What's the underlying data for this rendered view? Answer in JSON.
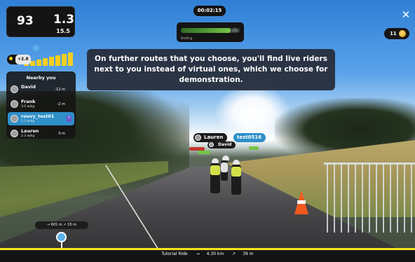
{
  "timer": "00:02:15",
  "stats": {
    "power": "93",
    "power_unit_top": "",
    "power_unit_bottom": "",
    "wkg": "1.3",
    "wkg_unit": "",
    "speed": "15.5"
  },
  "drafting": {
    "label": "Drafting",
    "level": 0.85
  },
  "message": "On further routes that you choose, you'll find live riders next to you instead of virtual ones, which we choose for demonstration.",
  "coins": {
    "count": "11"
  },
  "grade": {
    "value": "+2.8"
  },
  "nearby": {
    "title": "Nearby you",
    "riders": [
      {
        "name": "David",
        "wkg": "",
        "gap": "-12 m",
        "me": false
      },
      {
        "name": "Frank",
        "wkg": "3.0 w/kg",
        "gap": "-2 m",
        "me": false
      },
      {
        "name": "rouvy_test01",
        "wkg": "1.3 w/kg",
        "gap": "",
        "me": true,
        "badge": "7"
      },
      {
        "name": "Lauren",
        "wkg": "2.3 w/kg",
        "gap": "0 m",
        "me": false
      }
    ]
  },
  "world_tags": [
    {
      "name": "Lauren"
    },
    {
      "name": "test0516"
    },
    {
      "name": "David"
    }
  ],
  "distance_pill": {
    "distance": "601 m",
    "elevation": "15 m"
  },
  "route": {
    "progress": 0.15,
    "name": "Tutorial Ride",
    "distance": "4.30 km",
    "elevation": "39 m"
  },
  "colors": {
    "accent": "#f6e51b",
    "player": "#2e8fc9",
    "draft": "#74c446"
  }
}
